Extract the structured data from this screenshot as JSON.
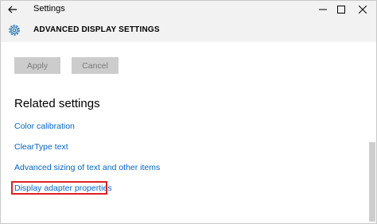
{
  "window": {
    "title": "Settings"
  },
  "header": {
    "title": "ADVANCED DISPLAY SETTINGS"
  },
  "buttons": {
    "apply": "Apply",
    "cancel": "Cancel"
  },
  "related": {
    "heading": "Related settings",
    "links": [
      "Color calibration",
      "ClearType text",
      "Advanced sizing of text and other items",
      "Display adapter properties"
    ]
  },
  "icons": {
    "back": "back-arrow-icon",
    "settings": "gear-icon",
    "minimize": "minimize-icon",
    "maximize": "maximize-icon",
    "close": "close-icon"
  },
  "colors": {
    "link": "#0066cc",
    "highlight": "#e02020",
    "titlebar": "#f2f2f2",
    "button_disabled": "#cccccc"
  }
}
